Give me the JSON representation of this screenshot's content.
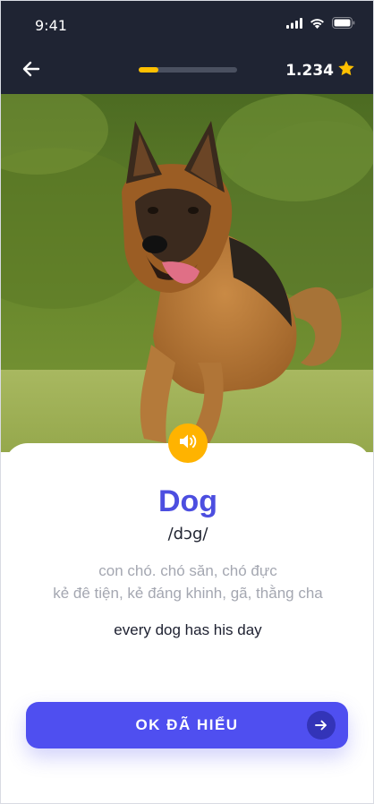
{
  "status_bar": {
    "time": "9:41",
    "icons": [
      "signal-icon",
      "wifi-icon",
      "battery-icon"
    ]
  },
  "header": {
    "back_icon": "arrow-left-icon",
    "progress_fraction": 0.2,
    "score": "1.234",
    "score_icon": "star-icon"
  },
  "flashcard": {
    "image": "german-shepherd-dog-photo",
    "speaker_icon": "speaker-icon",
    "word": "Dog",
    "phonetic": "/dɔg/",
    "meanings": [
      "con chó. chó săn, chó đực",
      "kẻ đê tiện, kẻ đáng khinh, gã, thằng cha"
    ],
    "example": "every dog has his day"
  },
  "cta": {
    "label": "OK ĐÃ HIỂU",
    "icon": "arrow-right-icon"
  },
  "colors": {
    "header_bg": "#1f2433",
    "accent": "#4f4ff0",
    "word": "#4c4ee0",
    "progress": "#ffc000",
    "speaker": "#ffb300",
    "star": "#ffc000",
    "meaning_text": "#a4a7b1"
  }
}
